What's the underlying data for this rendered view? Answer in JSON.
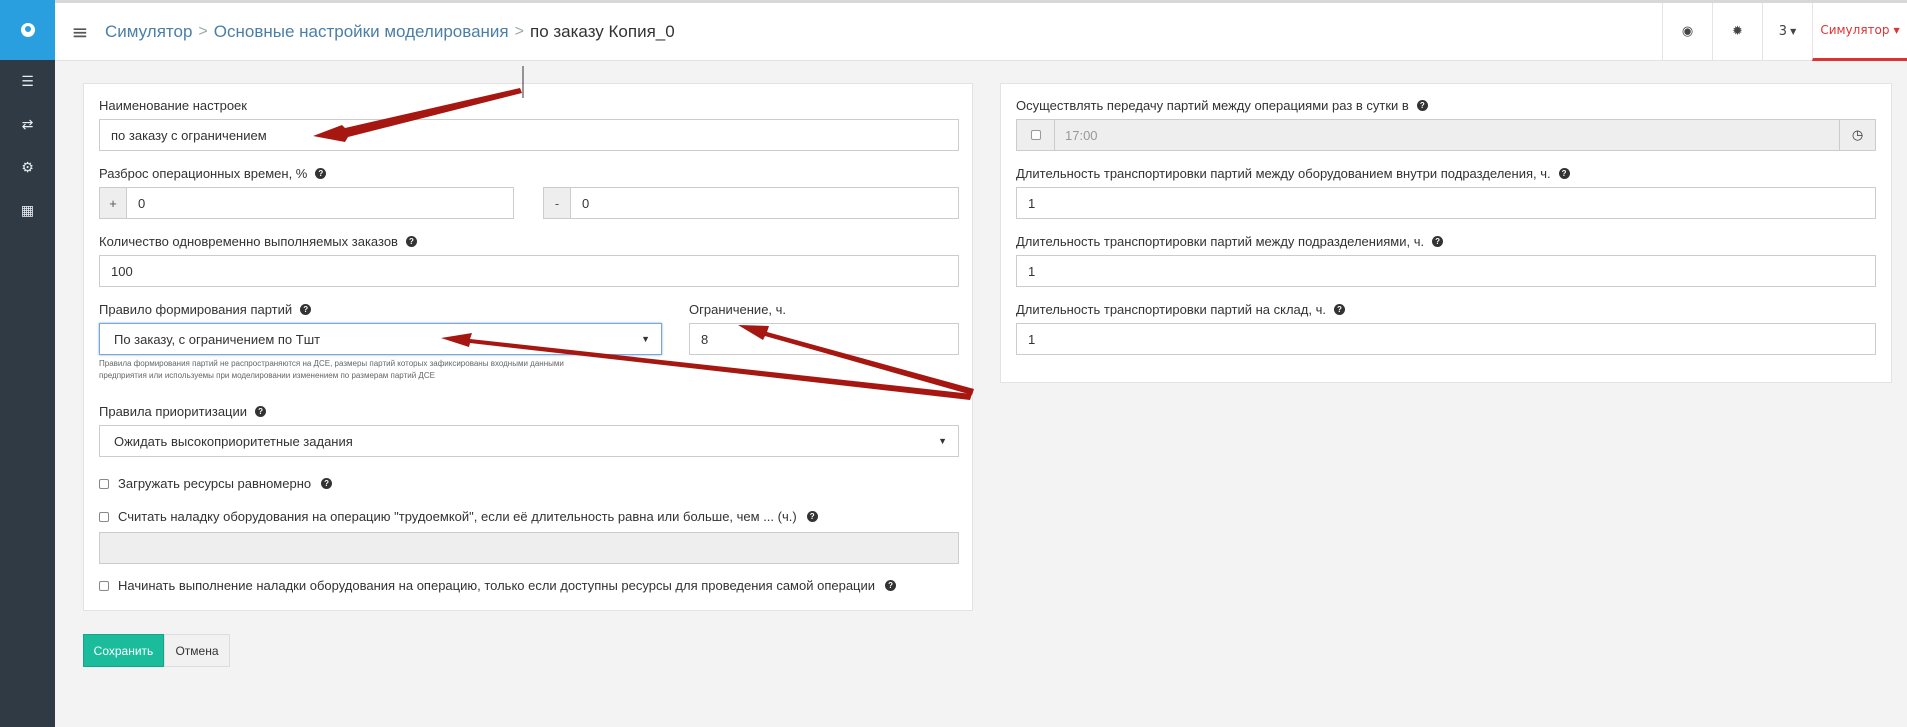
{
  "app": {
    "breadcrumb": [
      "Симулятор",
      "Основные настройки моделирования",
      "по заказу Копия_0"
    ],
    "separator": ">"
  },
  "sidebar": {
    "icons": [
      "globe-logo-icon",
      "list-icon",
      "exchange-icon",
      "cogs-icon",
      "calculator-icon"
    ]
  },
  "topbar": {
    "menu_icon": "hamburger-icon",
    "globe_icon": "globe-icon",
    "gear_icon": "gear-icon",
    "counter": "3",
    "user_menu": "Симулятор"
  },
  "left": {
    "name_label": "Наименование настроек",
    "name_value": "по заказу с ограничением",
    "spread_label": "Разброс операционных времен, %",
    "spread_plus_sign": "+",
    "spread_plus_value": "0",
    "spread_minus_sign": "-",
    "spread_minus_value": "0",
    "orders_label": "Количество одновременно выполняемых заказов",
    "orders_value": "100",
    "batch_rule_label": "Правило формирования партий",
    "batch_rule_value": "По заказу, с ограничением по Тшт",
    "limit_label": "Ограничение, ч.",
    "limit_value": "8",
    "batch_help_line1": "Правила формирования партий не распространяются на ДСЕ, размеры партий которых зафиксированы входными данными",
    "batch_help_line2": "предприятия или используемы при моделировании изменением по размерам партий ДСЕ",
    "priority_label": "Правила приоритизации",
    "priority_value": "Ожидать высокоприоритетные задания",
    "check_load_even": "Загружать ресурсы равномерно",
    "check_setup_labor": "Считать наладку оборудования на операцию \"трудоемкой\", если её длительность равна или больше, чем ... (ч.)",
    "setup_labor_value": "",
    "check_setup_start": "Начинать выполнение наладки оборудования на операцию, только если доступны ресурсы для проведения самой операции"
  },
  "right": {
    "transfer_label": "Осуществлять передачу партий между операциями раз в сутки в",
    "transfer_time": "17:00",
    "inner_transport_label": "Длительность транспортировки партий между оборудованием внутри подразделения, ч.",
    "inner_transport_value": "1",
    "dept_transport_label": "Длительность транспортировки партий между подразделениями, ч.",
    "dept_transport_value": "1",
    "warehouse_transport_label": "Длительность транспортировки партий на склад, ч.",
    "warehouse_transport_value": "1"
  },
  "actions": {
    "save": "Сохранить",
    "cancel": "Отмена"
  },
  "colors": {
    "sidebar": "#2f3a45",
    "logo": "#2a9fe0",
    "link": "#4a7fa8",
    "save": "#1abc9c",
    "accent_red": "#d33",
    "annotation_arrow": "#a61712"
  }
}
